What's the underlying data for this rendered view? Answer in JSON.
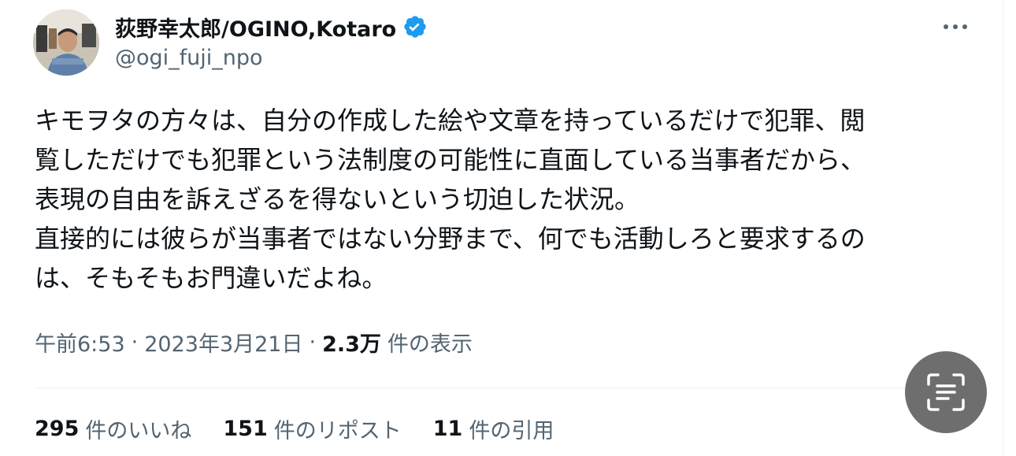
{
  "author": {
    "display_name": "荻野幸太郎/OGINO,Kotaro",
    "handle": "@ogi_fuji_npo",
    "verified": true
  },
  "tweet": {
    "lines": [
      "キモヲタの方々は、自分の作成した絵や文章を持っているだけで犯罪、閲",
      "覧しただけでも犯罪という法制度の可能性に直面している当事者だから、",
      "表現の自由を訴えざるを得ないという切迫した状況。",
      "直接的には彼らが当事者ではない分野まで、何でも活動しろと要求するの",
      "は、そもそもお門違いだよね。"
    ]
  },
  "meta": {
    "time": "午前6:53",
    "separator": "·",
    "date": "2023年3月21日",
    "views_count": "2.3万",
    "views_label": "件の表示"
  },
  "stats": {
    "likes_count": "295",
    "likes_label": "件のいいね",
    "reposts_count": "151",
    "reposts_label": "件のリポスト",
    "quotes_count": "11",
    "quotes_label": "件の引用"
  },
  "icons": {
    "verified": "verified-badge-icon",
    "more": "more-options-icon",
    "scan": "text-scan-icon"
  },
  "colors": {
    "text_primary": "#0f1419",
    "text_secondary": "#536471",
    "verified_blue": "#1d9bf0",
    "scan_button_bg": "#6e6e6e"
  }
}
